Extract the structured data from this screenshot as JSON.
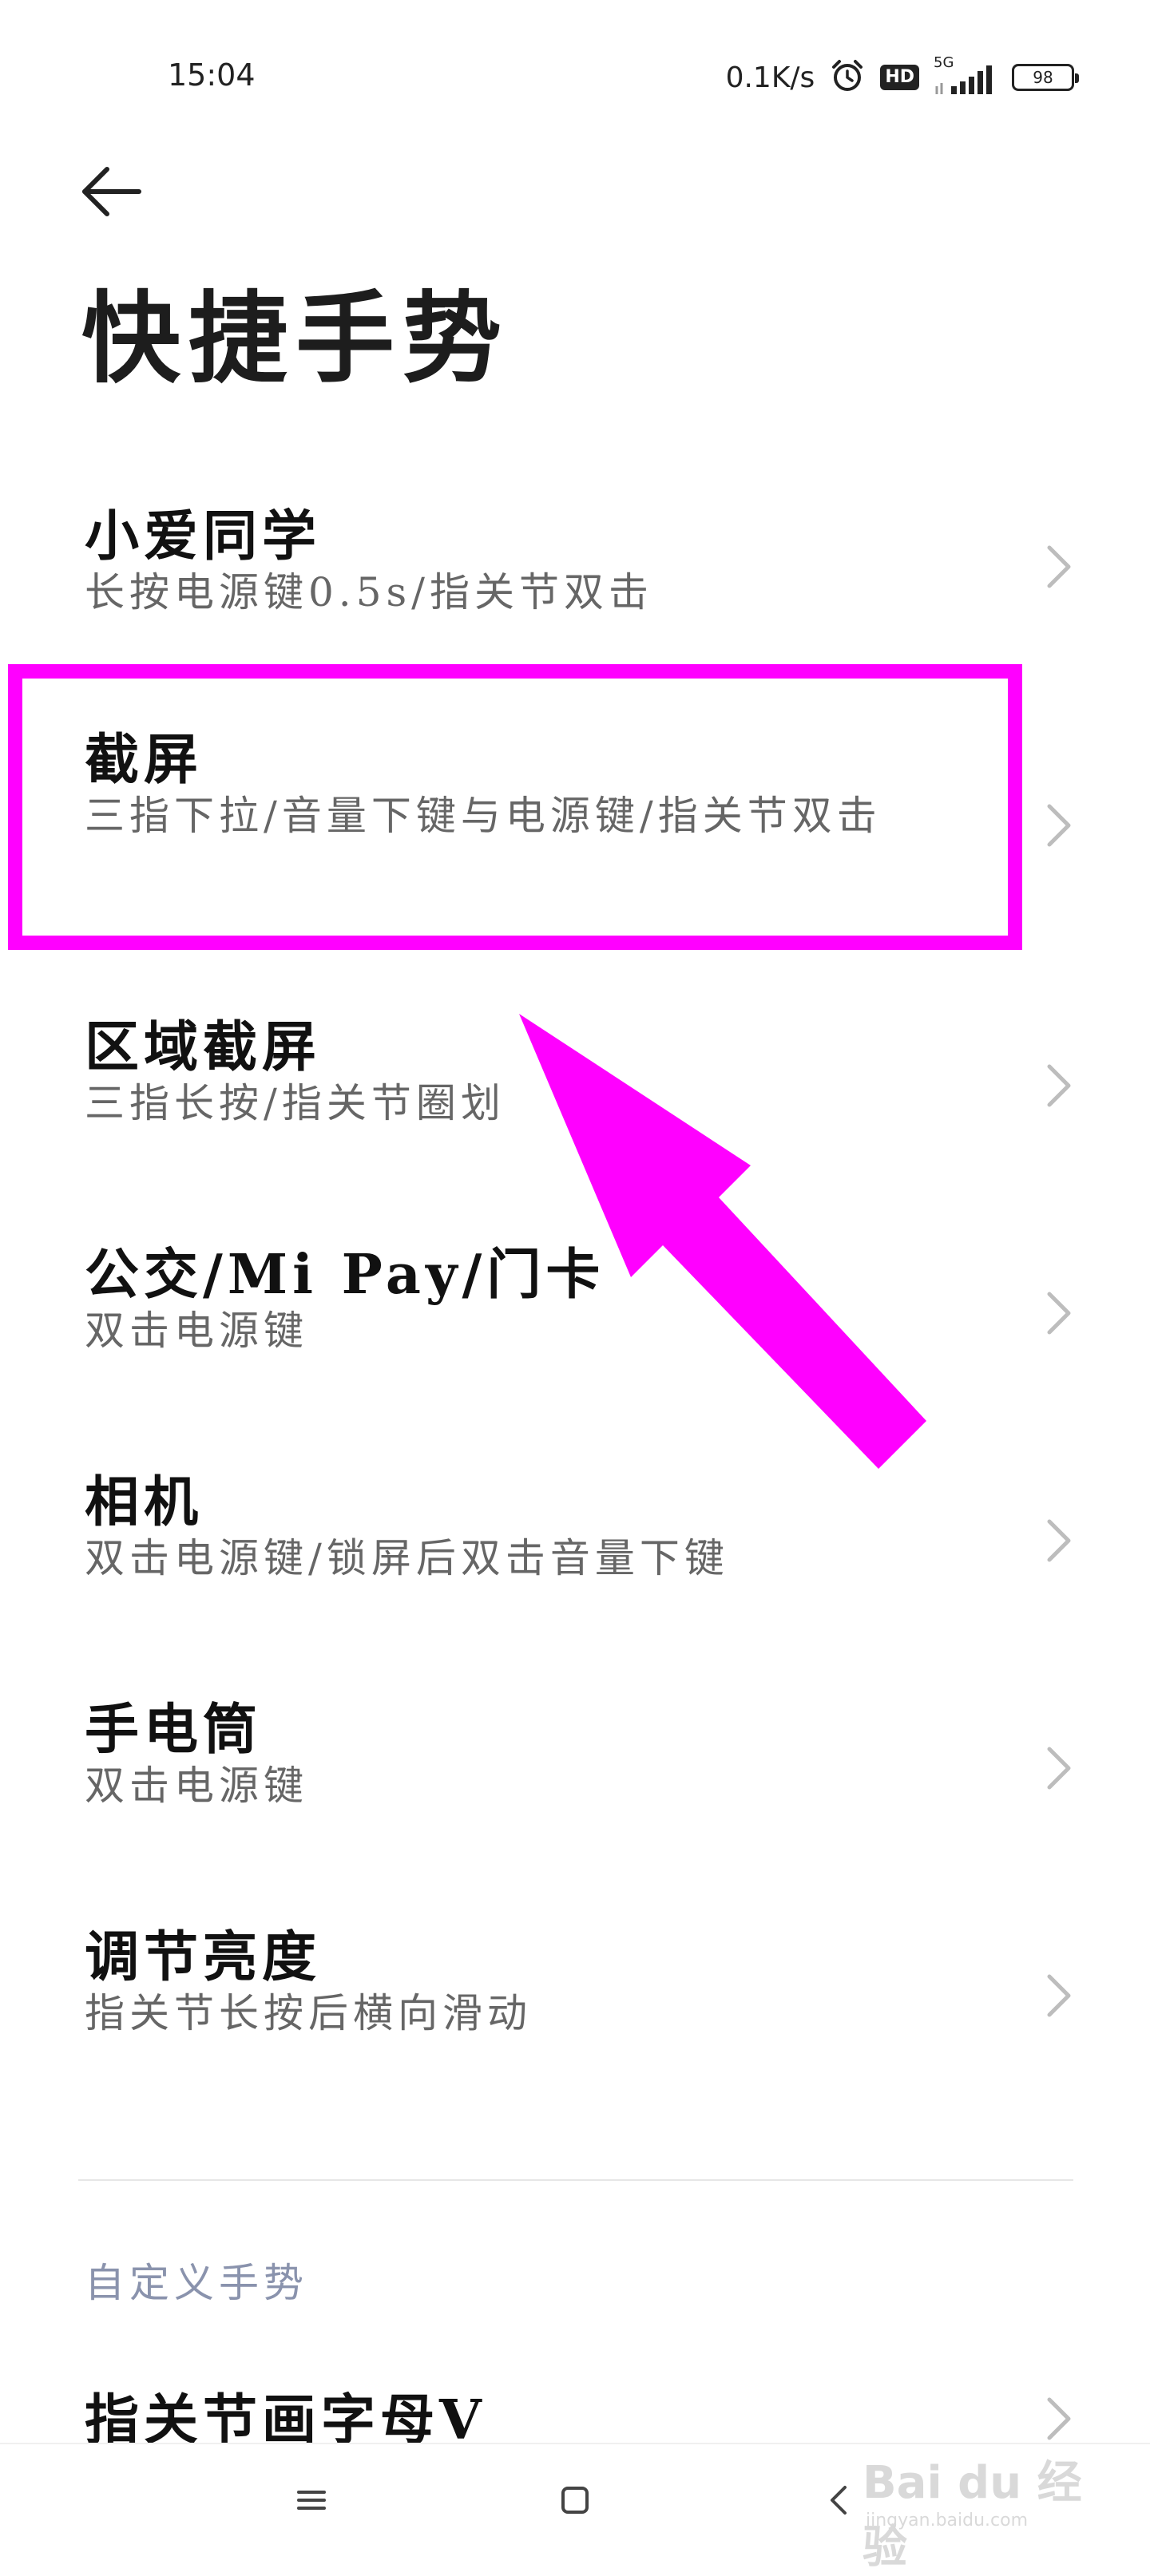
{
  "status_bar": {
    "time": "15:04",
    "net_speed": "0.1K/s",
    "hd_label": "HD",
    "network_type": "5G",
    "battery_level": "98"
  },
  "page": {
    "title": "快捷手势"
  },
  "items": [
    {
      "title": "小爱同学",
      "subtitle": "长按电源键0.5s/指关节双击"
    },
    {
      "title": "截屏",
      "subtitle": "三指下拉/音量下键与电源键/指关节双击"
    },
    {
      "title": "区域截屏",
      "subtitle": "三指长按/指关节圈划"
    },
    {
      "title": "公交/Mi Pay/门卡",
      "subtitle": "双击电源键"
    },
    {
      "title": "相机",
      "subtitle": "双击电源键/锁屏后双击音量下键"
    },
    {
      "title": "手电筒",
      "subtitle": "双击电源键"
    },
    {
      "title": "调节亮度",
      "subtitle": "指关节长按后横向滑动"
    },
    {
      "title": "指关节画字母V",
      "subtitle": ""
    }
  ],
  "custom_section": {
    "header": "自定义手势"
  },
  "annotation": {
    "highlight_color": "#ff00ff",
    "arrow_color": "#ff00ff"
  },
  "watermark": {
    "text": "Bai du 经验",
    "sub": "jingyan.baidu.com"
  },
  "icons": {
    "back": "back-arrow-icon",
    "chevron": "chevron-right-icon",
    "alarm": "alarm-clock-icon",
    "signal": "signal-bars-icon",
    "battery": "battery-icon",
    "nav_menu": "menu-icon",
    "nav_home": "home-square-icon",
    "nav_back": "back-triangle-icon"
  }
}
